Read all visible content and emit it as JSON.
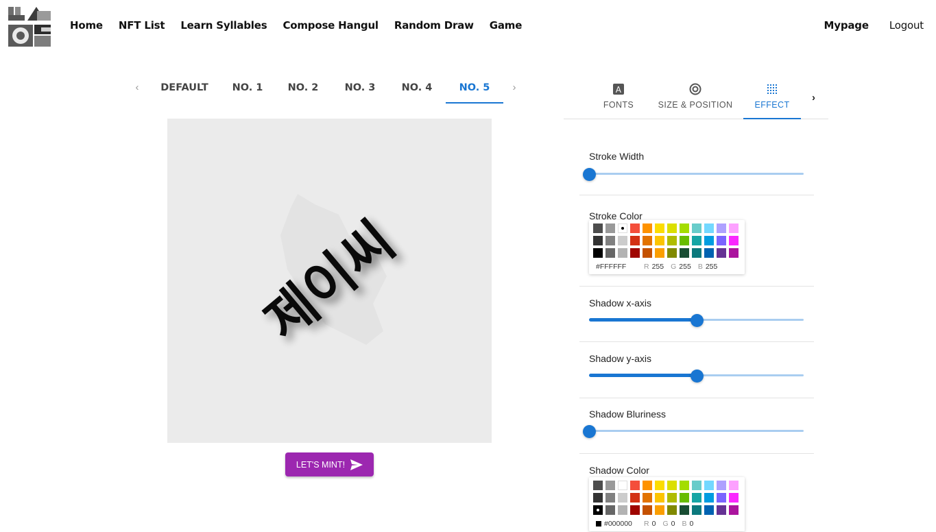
{
  "nav": {
    "links": [
      "Home",
      "NFT List",
      "Learn Syllables",
      "Compose Hangul",
      "Random Draw",
      "Game"
    ],
    "mypage": "Mypage",
    "logout": "Logout"
  },
  "design_tabs": {
    "prev_icon": "chevron-left-icon",
    "next_icon": "chevron-right-icon",
    "items": [
      "DEFAULT",
      "NO. 1",
      "NO. 2",
      "NO. 3",
      "NO. 4",
      "NO. 5"
    ],
    "active_index": 5
  },
  "canvas": {
    "text": "제이씨"
  },
  "mint_button": {
    "label": "LET'S MINT!",
    "icon": "send-icon",
    "color": "#9c27b0"
  },
  "settings_tabs": {
    "items": [
      {
        "label": "FONTS",
        "icon": "font-icon"
      },
      {
        "label": "SIZE & POSITION",
        "icon": "target-icon"
      },
      {
        "label": "EFFECT",
        "icon": "dots-grid-icon"
      }
    ],
    "active_index": 2,
    "next_icon": "chevron-right-icon"
  },
  "effects": {
    "stroke_width": {
      "label": "Stroke Width",
      "value_fraction": 0.0
    },
    "stroke_color": {
      "label": "Stroke Color",
      "hex": "#FFFFFF",
      "r": "255",
      "g": "255",
      "b": "255"
    },
    "shadow_x": {
      "label": "Shadow x-axis",
      "value_fraction": 0.5
    },
    "shadow_y": {
      "label": "Shadow y-axis",
      "value_fraction": 0.5
    },
    "shadow_blur": {
      "label": "Shadow Bluriness",
      "value_fraction": 0.0
    },
    "shadow_color": {
      "label": "Shadow Color",
      "hex": "#000000",
      "r": "0",
      "g": "0",
      "b": "0"
    }
  },
  "palette": {
    "rows": [
      [
        "#4D4D4D",
        "#999999",
        "#FFFFFF",
        "#F44E3B",
        "#FE9200",
        "#FCDC00",
        "#DBDF00",
        "#A4DD00",
        "#68CCCA",
        "#73D8FF",
        "#AEA1FF",
        "#FDA1FF"
      ],
      [
        "#333333",
        "#808080",
        "#CCCCCC",
        "#D33115",
        "#E27300",
        "#FCC400",
        "#B0BC00",
        "#68BC00",
        "#16A5A5",
        "#009CE0",
        "#7B64FF",
        "#FA28FF"
      ],
      [
        "#000000",
        "#666666",
        "#B3B3B3",
        "#9F0500",
        "#C45100",
        "#FB9E00",
        "#808900",
        "#194D33",
        "#0C797D",
        "#0062B1",
        "#653294",
        "#AB149E"
      ]
    ],
    "labels": {
      "r": "R",
      "g": "G",
      "b": "B"
    }
  },
  "colors": {
    "accent": "#1976d2",
    "slider_rail": "#a9cdf0",
    "canvas_bg": "#ebebeb"
  }
}
